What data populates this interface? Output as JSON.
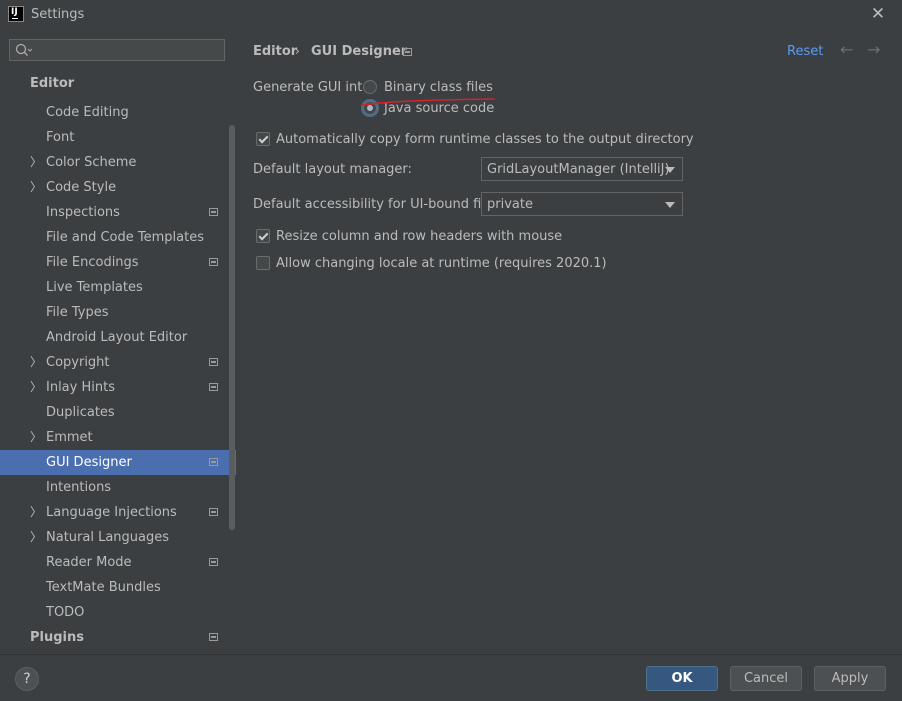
{
  "window": {
    "title": "Settings",
    "app_icon_text": "IJ"
  },
  "sidebar": {
    "search": {
      "placeholder": ""
    },
    "items": [
      {
        "label": "Editor",
        "type": "group"
      },
      {
        "label": "Code Editing"
      },
      {
        "label": "Font"
      },
      {
        "label": "Color Scheme",
        "expandable": true
      },
      {
        "label": "Code Style",
        "expandable": true
      },
      {
        "label": "Inspections",
        "project_icon": true
      },
      {
        "label": "File and Code Templates"
      },
      {
        "label": "File Encodings",
        "project_icon": true
      },
      {
        "label": "Live Templates"
      },
      {
        "label": "File Types"
      },
      {
        "label": "Android Layout Editor"
      },
      {
        "label": "Copyright",
        "expandable": true,
        "project_icon": true
      },
      {
        "label": "Inlay Hints",
        "expandable": true,
        "project_icon": true
      },
      {
        "label": "Duplicates"
      },
      {
        "label": "Emmet",
        "expandable": true
      },
      {
        "label": "GUI Designer",
        "project_icon": true,
        "selected": true
      },
      {
        "label": "Intentions"
      },
      {
        "label": "Language Injections",
        "expandable": true,
        "project_icon": true
      },
      {
        "label": "Natural Languages",
        "expandable": true
      },
      {
        "label": "Reader Mode",
        "project_icon": true
      },
      {
        "label": "TextMate Bundles"
      },
      {
        "label": "TODO"
      },
      {
        "label": "Plugins",
        "type": "group",
        "project_icon": true
      }
    ]
  },
  "header": {
    "breadcrumb_parent": "Editor",
    "breadcrumb_separator": "›",
    "breadcrumb_current": "GUI Designer",
    "reset_label": "Reset",
    "back_arrow": "←",
    "forward_arrow": "→"
  },
  "form": {
    "generate_label": "Generate GUI into:",
    "generate_options": [
      {
        "label": "Binary class files",
        "selected": false
      },
      {
        "label": "Java source code",
        "selected": true
      }
    ],
    "copy_runtime": {
      "label": "Automatically copy form runtime classes to the output directory",
      "checked": true
    },
    "layout_manager": {
      "label": "Default layout manager:",
      "value": "GridLayoutManager (IntelliJ)"
    },
    "accessibility": {
      "label": "Default accessibility for UI-bound fields:",
      "value": "private"
    },
    "resize_headers": {
      "label": "Resize column and row headers with mouse",
      "checked": true
    },
    "allow_locale": {
      "label": "Allow changing locale at runtime (requires 2020.1)",
      "checked": false
    }
  },
  "footer": {
    "help_label": "?",
    "ok_label": "OK",
    "cancel_label": "Cancel",
    "apply_label": "Apply"
  },
  "colors": {
    "background": "#3c3f41",
    "selection": "#4b6eaf",
    "link": "#589df6",
    "annotation": "#d2232a"
  }
}
